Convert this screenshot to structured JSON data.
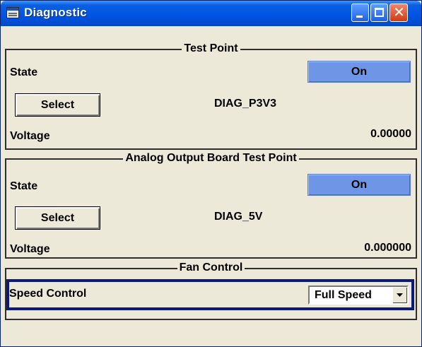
{
  "window": {
    "title": "Diagnostic",
    "icons": {
      "app": "window-app-icon",
      "minimize": "minimize-icon",
      "maximize": "maximize-icon",
      "close": "close-icon"
    },
    "close_glyph": "✕"
  },
  "test_point": {
    "title": "Test Point",
    "state_label": "State",
    "state_value": "On",
    "select_label": "Select",
    "selected_point": "DIAG_P3V3",
    "voltage_label": "Voltage",
    "voltage_value": "0.00000"
  },
  "analog_output": {
    "title": "Analog Output Board Test Point",
    "state_label": "State",
    "state_value": "On",
    "select_label": "Select",
    "selected_point": "DIAG_5V",
    "voltage_label": "Voltage",
    "voltage_value": "0.000000"
  },
  "fan_control": {
    "title": "Fan Control",
    "speed_label": "Speed Control",
    "speed_value": "Full Speed",
    "dropdown_icon": "chevron-down-icon"
  },
  "colors": {
    "titlebar": "#0055e5",
    "on_button": "#6f96e6",
    "focus_border": "#0b1a7a",
    "panel_background": "#ece9d8"
  }
}
